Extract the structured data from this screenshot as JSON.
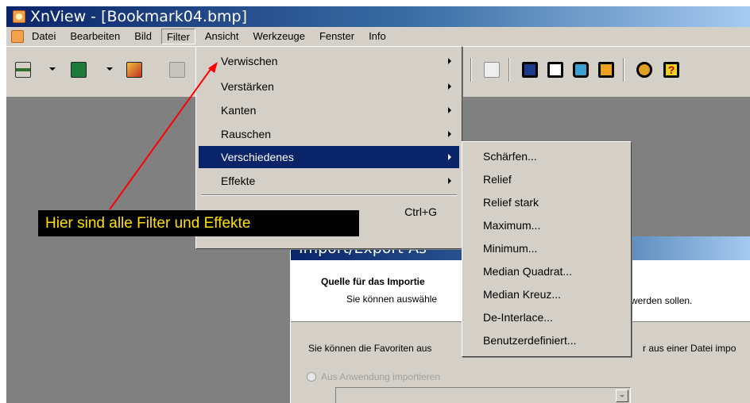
{
  "window": {
    "title": "XnView - [Bookmark04.bmp]",
    "icon": "xnview-app-icon"
  },
  "menubar": {
    "items": [
      "Datei",
      "Bearbeiten",
      "Bild",
      "Filter",
      "Ansicht",
      "Werkzeuge",
      "Fenster",
      "Info"
    ],
    "active": "Filter"
  },
  "toolbar": {
    "icons": [
      "bookmark-tree-icon",
      "open-image-icon",
      "photo-icon",
      "disabled-tool-icon",
      "page-icon",
      "fullscreen-icon",
      "print-icon",
      "convert-icon",
      "camera-icon",
      "settings-icon",
      "help-icon"
    ]
  },
  "filter_menu": {
    "items": [
      {
        "label": "Verwischen",
        "submenu": true
      },
      {
        "label": "Verstärken",
        "submenu": true
      },
      {
        "label": "Kanten",
        "submenu": true
      },
      {
        "label": "Rauschen",
        "submenu": true
      },
      {
        "label": "Verschiedenes",
        "submenu": true,
        "highlighted": true
      },
      {
        "label": "Effekte",
        "submenu": true
      }
    ],
    "extra_shortcut": "Ctrl+G"
  },
  "verschiedenes_submenu": {
    "items": [
      "Schärfen...",
      "Relief",
      "Relief stark",
      "Maximum...",
      "Minimum...",
      "Median Quadrat...",
      "Median Kreuz...",
      "De-Interlace...",
      "Benutzerdefiniert..."
    ]
  },
  "dialog": {
    "title": "Import/Export-As",
    "heading": "Quelle für das Importie",
    "subtext": "Sie können auswähle",
    "subtext_right": "werden sollen.",
    "body_text": "Sie können die Favoriten aus",
    "body_text_right": "r aus einer Datei impo",
    "radio_label": "Aus Anwendung importieren"
  },
  "annotation": {
    "text": "Hier sind alle Filter und Effekte",
    "arrow_color": "#ff0000",
    "background": "#000000",
    "text_color": "#ffe000"
  },
  "colors": {
    "titlebar_start": "#0a246a",
    "menu_highlight": "#0a246a",
    "face": "#d4d0c8",
    "workspace": "#808080"
  }
}
